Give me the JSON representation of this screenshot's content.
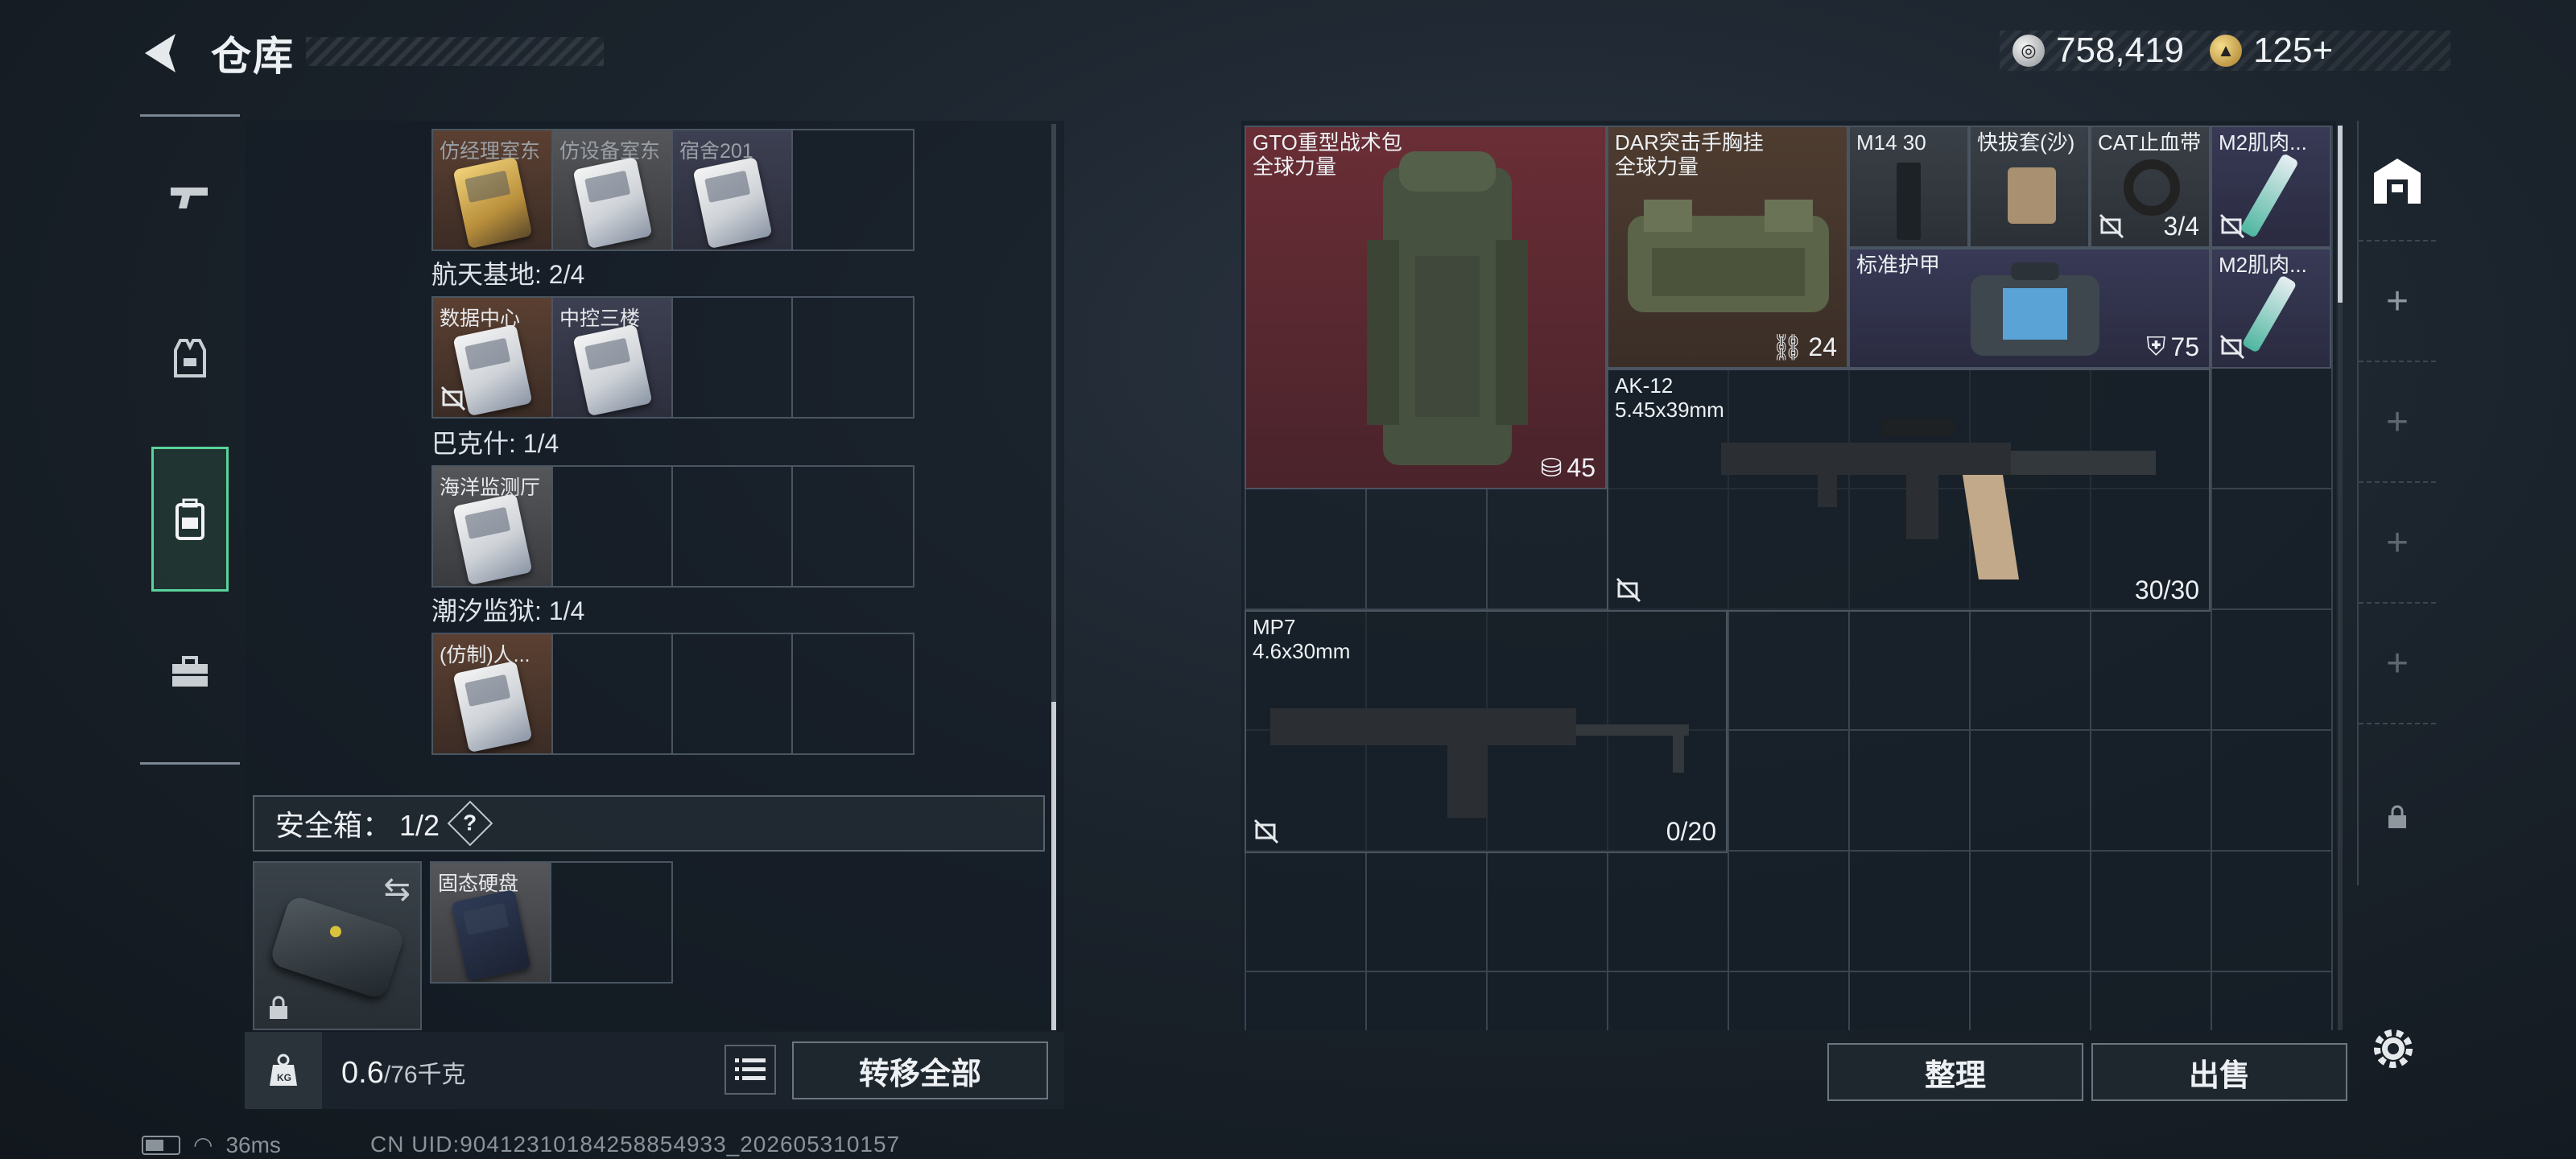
{
  "header": {
    "title": "仓库",
    "currency_silver": "758,419",
    "currency_gold": "125+",
    "back_icon": "chevron-left-icon"
  },
  "nav": {
    "items": [
      {
        "name": "weapons",
        "icon": "pistol-icon"
      },
      {
        "name": "equipment",
        "icon": "vest-icon"
      },
      {
        "name": "backpack",
        "icon": "backpack-icon",
        "active": true
      },
      {
        "name": "toolbox",
        "icon": "toolbox-icon"
      }
    ]
  },
  "left": {
    "row0": [
      "仿经理室东",
      "仿设备室东",
      "宿舍201"
    ],
    "regions": [
      {
        "label": "航天基地: 2/4",
        "cells": [
          "数据中心",
          "中控三楼"
        ]
      },
      {
        "label": "巴克什: 1/4",
        "cells": [
          "海洋监测厅"
        ]
      },
      {
        "label": "潮汐监狱: 1/4",
        "cells": [
          "(仿制)人..."
        ]
      }
    ],
    "safe_label": "安全箱：  1/2",
    "safe_help": "?",
    "safe_items": [
      "固态硬盘"
    ],
    "weight_value": "0.6",
    "weight_max": "/76千克",
    "transfer_all": "转移全部"
  },
  "stash": {
    "items": [
      {
        "name": "GTO重型战术包\n全球力量",
        "count": "45",
        "count_icon": "backpack-slot-icon"
      },
      {
        "name": "DAR突击手胸挂\n全球力量",
        "count": "24",
        "count_icon": "vest-slot-icon"
      },
      {
        "name": "M14 30"
      },
      {
        "name": "快拔套(沙)"
      },
      {
        "name": "CAT止血带",
        "count": "3/4"
      },
      {
        "name": "M2肌肉..."
      },
      {
        "name": "标准护甲",
        "count": "75",
        "count_icon": "armor-icon"
      },
      {
        "name": "M2肌肉..."
      },
      {
        "name": "AK-12\n5.45x39mm",
        "count": "30/30"
      },
      {
        "name": "MP7\n4.6x30mm",
        "count": "0/20"
      }
    ],
    "sort_label": "整理",
    "sell_label": "出售"
  },
  "status": {
    "ping": "36ms",
    "uid": "CN UID:90412310184258854933_202605310157"
  },
  "colors": {
    "accent": "#59d49c",
    "rarity_red": "#6a2e36",
    "rarity_brown": "#4e3c30",
    "rarity_navy": "#383a56"
  }
}
